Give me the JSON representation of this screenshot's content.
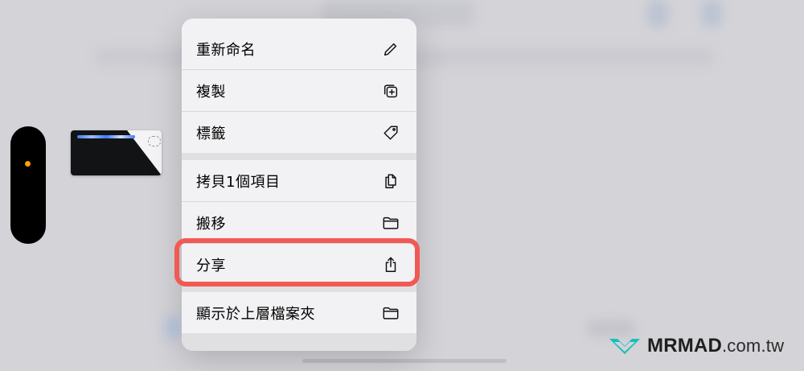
{
  "menu": {
    "rename": "重新命名",
    "duplicate": "複製",
    "tags": "標籤",
    "copy_item": "拷貝1個項目",
    "move": "搬移",
    "share": "分享",
    "show_in_folder": "顯示於上層檔案夾"
  },
  "icons": {
    "rename": "pencil-icon",
    "duplicate": "duplicate-icon",
    "tags": "tag-icon",
    "copy_item": "copy-doc-icon",
    "move": "folder-icon",
    "share": "share-icon",
    "show_in_folder": "folder-icon"
  },
  "colors": {
    "highlight": "#f15a54",
    "pill_dot": "#ff9f0a",
    "brand_teal": "#15c2b8"
  },
  "watermark": {
    "brand": "MRMAD",
    "suffix": ".com.tw"
  }
}
